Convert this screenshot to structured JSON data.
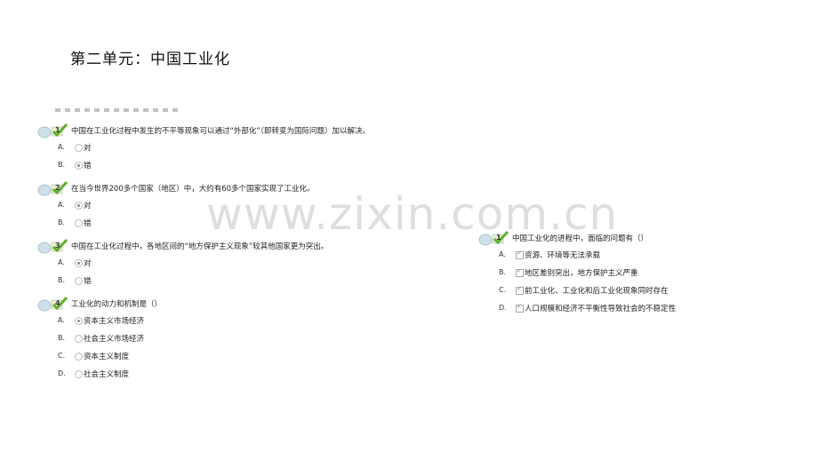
{
  "title": "第二单元：中国工业化",
  "watermark": "www.zixin.com.cn",
  "questions": [
    {
      "num": "1",
      "text": "中国在工业化过程中发生的不平等现象可以通过“外部化”（即转变为国际问题）加以解决。",
      "options": [
        {
          "label": "A.",
          "text": "对",
          "selected": false
        },
        {
          "label": "B.",
          "text": "错",
          "selected": true
        }
      ]
    },
    {
      "num": "2",
      "text": "在当今世界200多个国家（地区）中，大约有60多个国家实现了工业化。",
      "options": [
        {
          "label": "A.",
          "text": "对",
          "selected": true
        },
        {
          "label": "B.",
          "text": "错",
          "selected": false
        }
      ]
    },
    {
      "num": "3",
      "text": "中国在工业化过程中，各地区间的“地方保护主义现象”较其他国家更为突出。",
      "options": [
        {
          "label": "A.",
          "text": "对",
          "selected": true
        },
        {
          "label": "B.",
          "text": "错",
          "selected": false
        }
      ]
    },
    {
      "num": "4",
      "text": "工业化的动力和机制是（）",
      "options": [
        {
          "label": "A.",
          "text": "资本主义市场经济",
          "selected": true
        },
        {
          "label": "B.",
          "text": "社会主义市场经济",
          "selected": false
        },
        {
          "label": "C.",
          "text": "资本主义制度",
          "selected": false
        },
        {
          "label": "D.",
          "text": "社会主义制度",
          "selected": false
        }
      ]
    },
    {
      "num": "1",
      "text": "中国工业化的进程中，面临的问题有（）",
      "options": [
        {
          "label": "A.",
          "text": "资源、环境等无法承载",
          "selected": true
        },
        {
          "label": "B.",
          "text": "地区差别突出，地方保护主义严重",
          "selected": true
        },
        {
          "label": "C.",
          "text": "前工业化、工业化和后工业化现象同时存在",
          "selected": true
        },
        {
          "label": "D.",
          "text": "人口规模和经济不平衡性导致社会的不稳定性",
          "selected": true
        }
      ]
    }
  ]
}
